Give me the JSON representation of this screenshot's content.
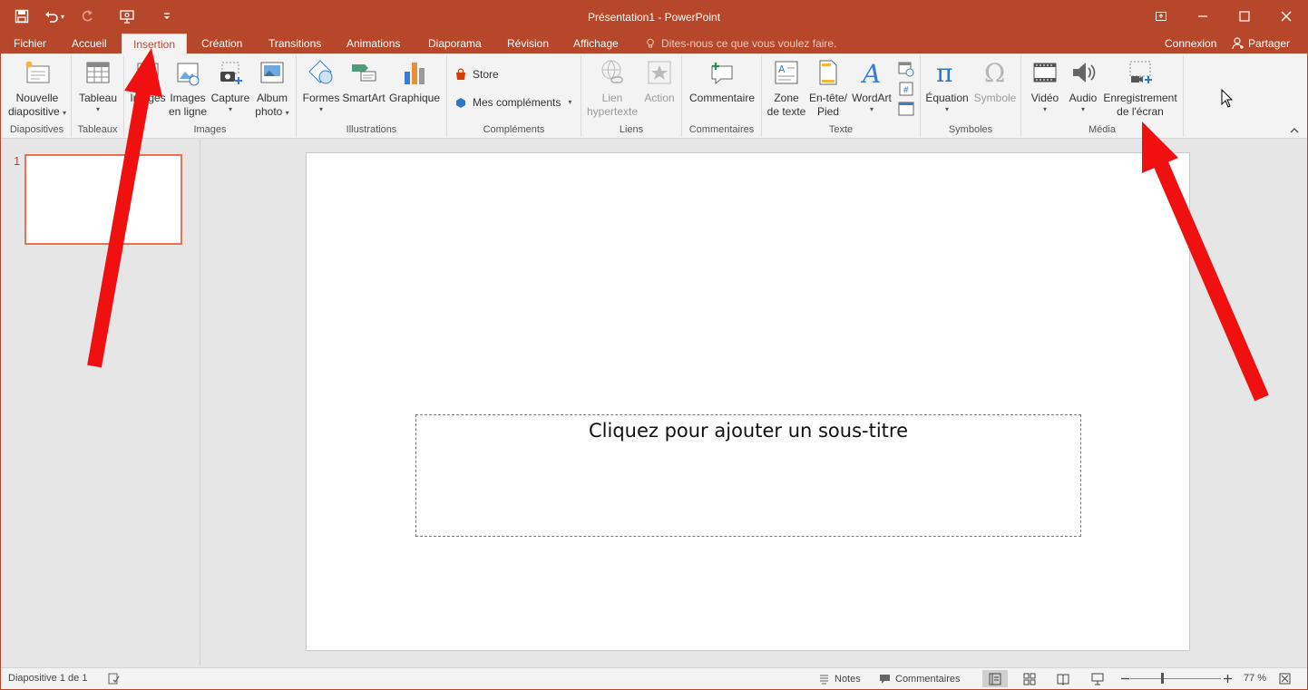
{
  "window": {
    "title": "Présentation1 - PowerPoint"
  },
  "qat": {
    "icons": [
      "save-icon",
      "undo-icon",
      "redo-icon",
      "present-from-start-icon",
      "customize-qat-icon"
    ]
  },
  "tabs": [
    {
      "label": "Fichier"
    },
    {
      "label": "Accueil"
    },
    {
      "label": "Insertion"
    },
    {
      "label": "Création"
    },
    {
      "label": "Transitions"
    },
    {
      "label": "Animations"
    },
    {
      "label": "Diaporama"
    },
    {
      "label": "Révision"
    },
    {
      "label": "Affichage"
    }
  ],
  "active_tab": "Insertion",
  "tellme": {
    "placeholder": "Dites-nous ce que vous voulez faire."
  },
  "account": {
    "signin": "Connexion",
    "share": "Partager"
  },
  "ribbon": {
    "groups": {
      "diapositives": "Diapositives",
      "tableaux": "Tableaux",
      "images": "Images",
      "illustrations": "Illustrations",
      "complements": "Compléments",
      "liens": "Liens",
      "commentaires": "Commentaires",
      "texte": "Texte",
      "symboles": "Symboles",
      "media": "Média"
    },
    "buttons": {
      "nouvelle_l1": "Nouvelle",
      "nouvelle_l2": "diapositive",
      "tableau": "Tableau",
      "images": "Images",
      "images_ligne_l1": "Images",
      "images_ligne_l2": "en ligne",
      "capture": "Capture",
      "album_l1": "Album",
      "album_l2": "photo",
      "formes": "Formes",
      "smartart": "SmartArt",
      "graphique": "Graphique",
      "store": "Store",
      "mes_complements": "Mes compléments",
      "lien_l1": "Lien",
      "lien_l2": "hypertexte",
      "action": "Action",
      "commentaire": "Commentaire",
      "zone_l1": "Zone",
      "zone_l2": "de texte",
      "entete_l1": "En-tête/",
      "entete_l2": "Pied",
      "wordart": "WordArt",
      "equation": "Équation",
      "symbole": "Symbole",
      "video": "Vidéo",
      "audio": "Audio",
      "enreg_l1": "Enregistrement",
      "enreg_l2": "de l'écran"
    }
  },
  "thumbnails": [
    {
      "number": "1"
    }
  ],
  "slide": {
    "subtitle_placeholder": "Cliquez pour ajouter un sous-titre"
  },
  "status": {
    "slide_info": "Diapositive 1 de 1",
    "notes": "Notes",
    "comments": "Commentaires",
    "zoom": "77 %"
  },
  "colors": {
    "accent": "#b7472a",
    "ribbon_bg": "#f3f3f3",
    "annotation_arrow": "#f01010"
  }
}
